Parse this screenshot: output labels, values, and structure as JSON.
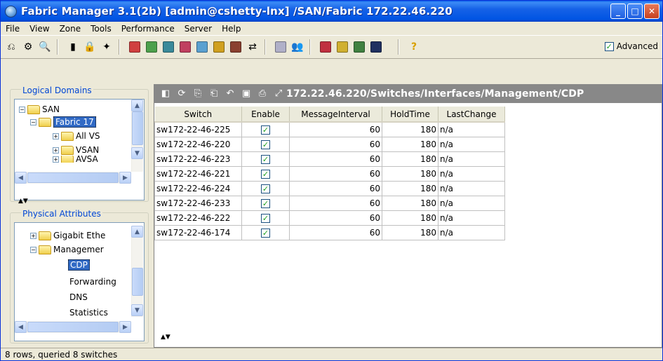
{
  "window": {
    "title": "Fabric Manager 3.1(2b) [admin@cshetty-lnx] /SAN/Fabric 172.22.46.220",
    "minimize": "_",
    "maximize": "□",
    "close": "✕"
  },
  "menu": [
    "File",
    "View",
    "Zone",
    "Tools",
    "Performance",
    "Server",
    "Help"
  ],
  "toolbar": {
    "advanced_label": "Advanced",
    "advanced_checked": true
  },
  "logical_domains": {
    "label": "Logical Domains",
    "items": [
      {
        "label": "SAN",
        "expander": "−"
      },
      {
        "label": "Fabric 17",
        "expander": "−"
      },
      {
        "label": "All VS",
        "expander": "+"
      },
      {
        "label": "VSAN",
        "expander": "+"
      },
      {
        "label": "AVSA",
        "expander": "+"
      }
    ]
  },
  "physical_attributes": {
    "label": "Physical Attributes",
    "items": [
      {
        "label": "Gigabit Ethe",
        "expander": "+"
      },
      {
        "label": "Managemer",
        "expander": "−"
      },
      {
        "label": "CDP"
      },
      {
        "label": "Forwarding"
      },
      {
        "label": "DNS"
      },
      {
        "label": "Statistics"
      }
    ]
  },
  "content": {
    "path": "172.22.46.220/Switches/Interfaces/Management/CDP",
    "columns": [
      "Switch",
      "Enable",
      "MessageInterval",
      "HoldTime",
      "LastChange"
    ],
    "rows": [
      {
        "switch": "sw172-22-46-225",
        "enable": true,
        "interval": "60",
        "hold": "180",
        "last": "n/a"
      },
      {
        "switch": "sw172-22-46-220",
        "enable": true,
        "interval": "60",
        "hold": "180",
        "last": "n/a"
      },
      {
        "switch": "sw172-22-46-223",
        "enable": true,
        "interval": "60",
        "hold": "180",
        "last": "n/a"
      },
      {
        "switch": "sw172-22-46-221",
        "enable": true,
        "interval": "60",
        "hold": "180",
        "last": "n/a"
      },
      {
        "switch": "sw172-22-46-224",
        "enable": true,
        "interval": "60",
        "hold": "180",
        "last": "n/a"
      },
      {
        "switch": "sw172-22-46-233",
        "enable": true,
        "interval": "60",
        "hold": "180",
        "last": "n/a"
      },
      {
        "switch": "sw172-22-46-222",
        "enable": true,
        "interval": "60",
        "hold": "180",
        "last": "n/a"
      },
      {
        "switch": "sw172-22-46-174",
        "enable": true,
        "interval": "60",
        "hold": "180",
        "last": "n/a"
      }
    ]
  },
  "status": "8 rows, queried 8 switches"
}
